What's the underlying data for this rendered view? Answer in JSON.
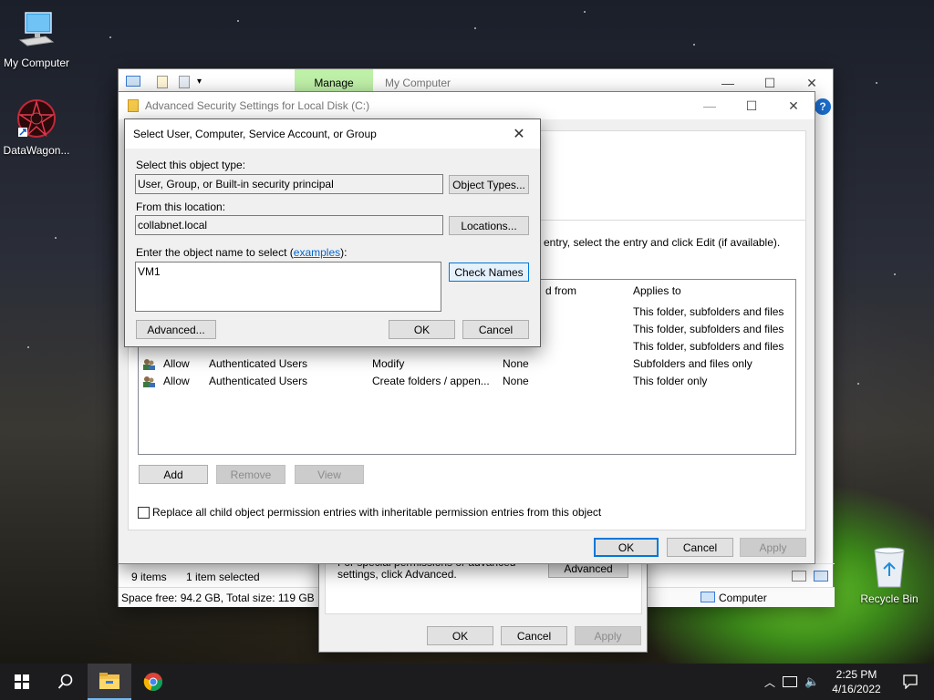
{
  "desktop": {
    "icons": [
      {
        "label": "My Computer"
      },
      {
        "label": "DataWagon..."
      },
      {
        "label": "Recycle Bin"
      }
    ]
  },
  "explorer": {
    "ribbon_tab_manage": "Manage",
    "title": "My Computer",
    "status_items": "9 items",
    "status_selected": "1 item selected",
    "space_free": "Space free: 94.2 GB, Total size: 119 GB",
    "computer_label": "Computer"
  },
  "properties": {
    "special_text": "For special permissions or advanced settings, click Advanced.",
    "advanced": "Advanced",
    "ok": "OK",
    "cancel": "Cancel",
    "apply": "Apply"
  },
  "adv_security": {
    "title": "Advanced Security Settings for Local Disk (C:)",
    "hint": "entry, select the entry and click Edit (if available).",
    "columns": {
      "inherited_from": "d from",
      "applies_to": "Applies to"
    },
    "rows": [
      {
        "type": "",
        "principal": "",
        "access": "",
        "inherited": "",
        "applies": "This folder, subfolders and files"
      },
      {
        "type": "",
        "principal": "",
        "access": "",
        "inherited": "",
        "applies": "This folder, subfolders and files"
      },
      {
        "type": "",
        "principal": "",
        "access": "",
        "inherited": "",
        "applies": "This folder, subfolders and files"
      },
      {
        "type": "Allow",
        "principal": "Authenticated Users",
        "access": "Modify",
        "inherited": "None",
        "applies": "Subfolders and files only"
      },
      {
        "type": "Allow",
        "principal": "Authenticated Users",
        "access": "Create folders / appen...",
        "inherited": "None",
        "applies": "This folder only"
      }
    ],
    "add": "Add",
    "remove": "Remove",
    "view": "View",
    "replace_label": "Replace all child object permission entries with inheritable permission entries from this object",
    "ok": "OK",
    "cancel": "Cancel",
    "apply": "Apply"
  },
  "select_dialog": {
    "title": "Select User, Computer, Service Account, or Group",
    "object_type_label": "Select this object type:",
    "object_type_value": "User, Group, or Built-in security principal",
    "object_types_btn": "Object Types...",
    "location_label": "From this location:",
    "location_value": "collabnet.local",
    "locations_btn": "Locations...",
    "enter_label": "Enter the object name to select (",
    "examples_link": "examples",
    "enter_label_end": "):",
    "name_value": "VM1",
    "check_names": "Check Names",
    "advanced": "Advanced...",
    "ok": "OK",
    "cancel": "Cancel"
  },
  "taskbar": {
    "time": "2:25 PM",
    "date": "4/16/2022"
  }
}
